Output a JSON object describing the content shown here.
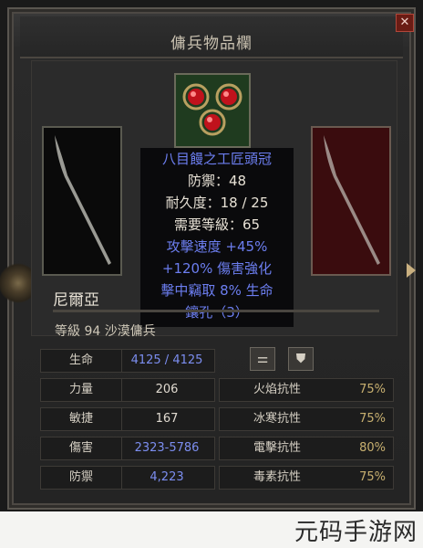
{
  "window": {
    "title": "傭兵物品欄",
    "close_label": "✕"
  },
  "tooltip": {
    "name": "八目饅之工匠頭冠",
    "defense": "防禦：48",
    "durability": "耐久度：18 / 25",
    "required_level": "需要等級：65",
    "mod_attack_speed": "攻擊速度 +45%",
    "mod_damage": "+120% 傷害強化",
    "mod_crushing": "擊中竊取 8% 生命",
    "sockets": "鑲孔（3）"
  },
  "mercenary": {
    "name": "尼爾亞",
    "level_text": "等級 94 沙漠傭兵"
  },
  "buttons": {
    "stats_toggle": "⚌",
    "shield_icon": "shield-icon"
  },
  "stats": [
    {
      "label": "生命",
      "value": "4125 / 4125"
    },
    {
      "label": "力量",
      "value": "206"
    },
    {
      "label": "敏捷",
      "value": "167"
    },
    {
      "label": "傷害",
      "value": "2323-5786"
    },
    {
      "label": "防禦",
      "value": "4,223"
    }
  ],
  "resistances": [
    {
      "label": "火焰抗性",
      "value": "75%"
    },
    {
      "label": "冰寒抗性",
      "value": "75%"
    },
    {
      "label": "電擊抗性",
      "value": "80%"
    },
    {
      "label": "毒素抗性",
      "value": "75%"
    }
  ],
  "watermark": "元码手游网",
  "colors": {
    "magic_blue": "#6c7ef0",
    "resist_gold": "#c8b070",
    "close_red": "#6a1c14"
  }
}
